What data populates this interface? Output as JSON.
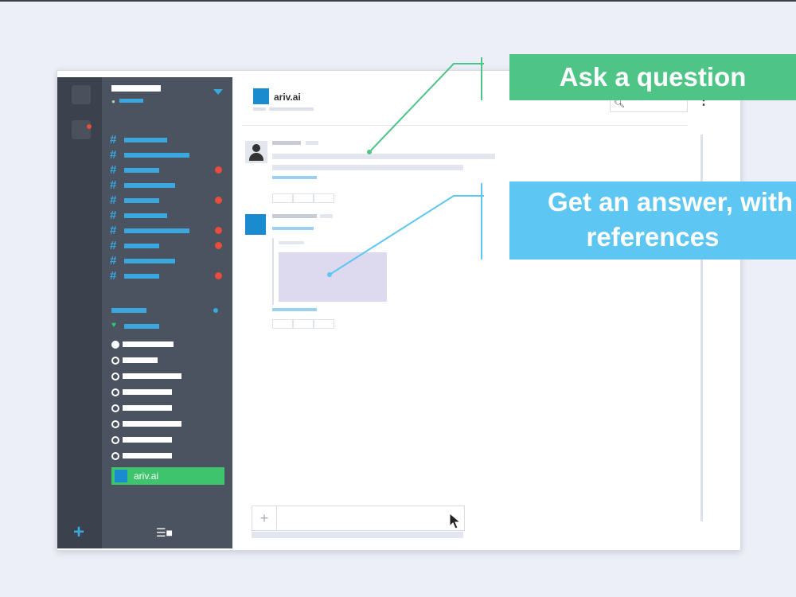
{
  "main": {
    "header": {
      "title": "ariv.ai"
    }
  },
  "sidebar": {
    "bot_label": "ariv.ai",
    "footer_icon": "view-toggle-icon"
  },
  "composer": {
    "attach_icon": "plus-icon",
    "send_icon": "send-icon"
  },
  "callouts": {
    "ask": "Ask a question",
    "answer_line1": "Get an answer, with",
    "answer_line2": "references"
  },
  "colors": {
    "accent_blue": "#3aa8df",
    "brand_blue": "#1b8bd0",
    "green": "#4fc487",
    "sky": "#5ec6f2",
    "sidebar_dark": "#4b5260",
    "rail_dark": "#3c424d",
    "unread_red": "#e74c3c"
  }
}
